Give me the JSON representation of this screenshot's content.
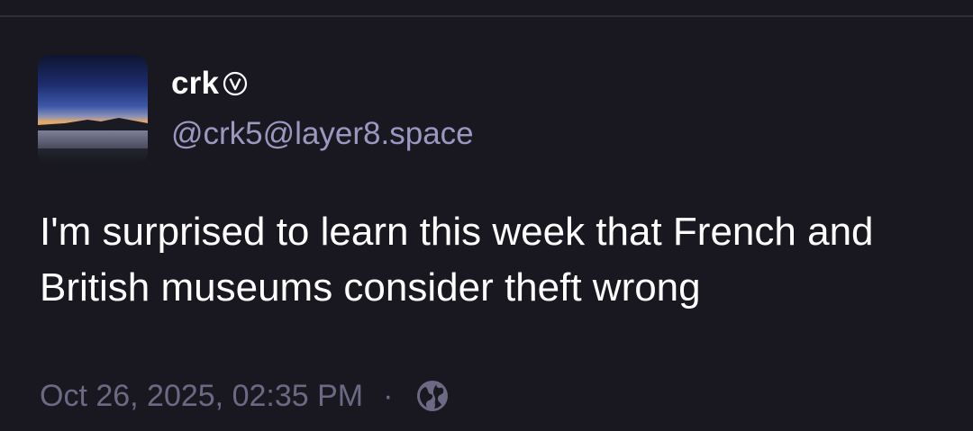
{
  "post": {
    "display_name": "crk",
    "handle": "@crk5@layer8.space",
    "text": "I'm surprised to learn this week that French and British museums consider theft wrong",
    "timestamp": "Oct 26, 2025, 02:35 PM",
    "separator": "·",
    "badge_icon": "bot-badge-icon",
    "visibility_icon": "globe-icon"
  },
  "colors": {
    "background": "#191820",
    "name": "#ffffff",
    "handle": "#9a98c0",
    "meta": "#6b6984"
  }
}
